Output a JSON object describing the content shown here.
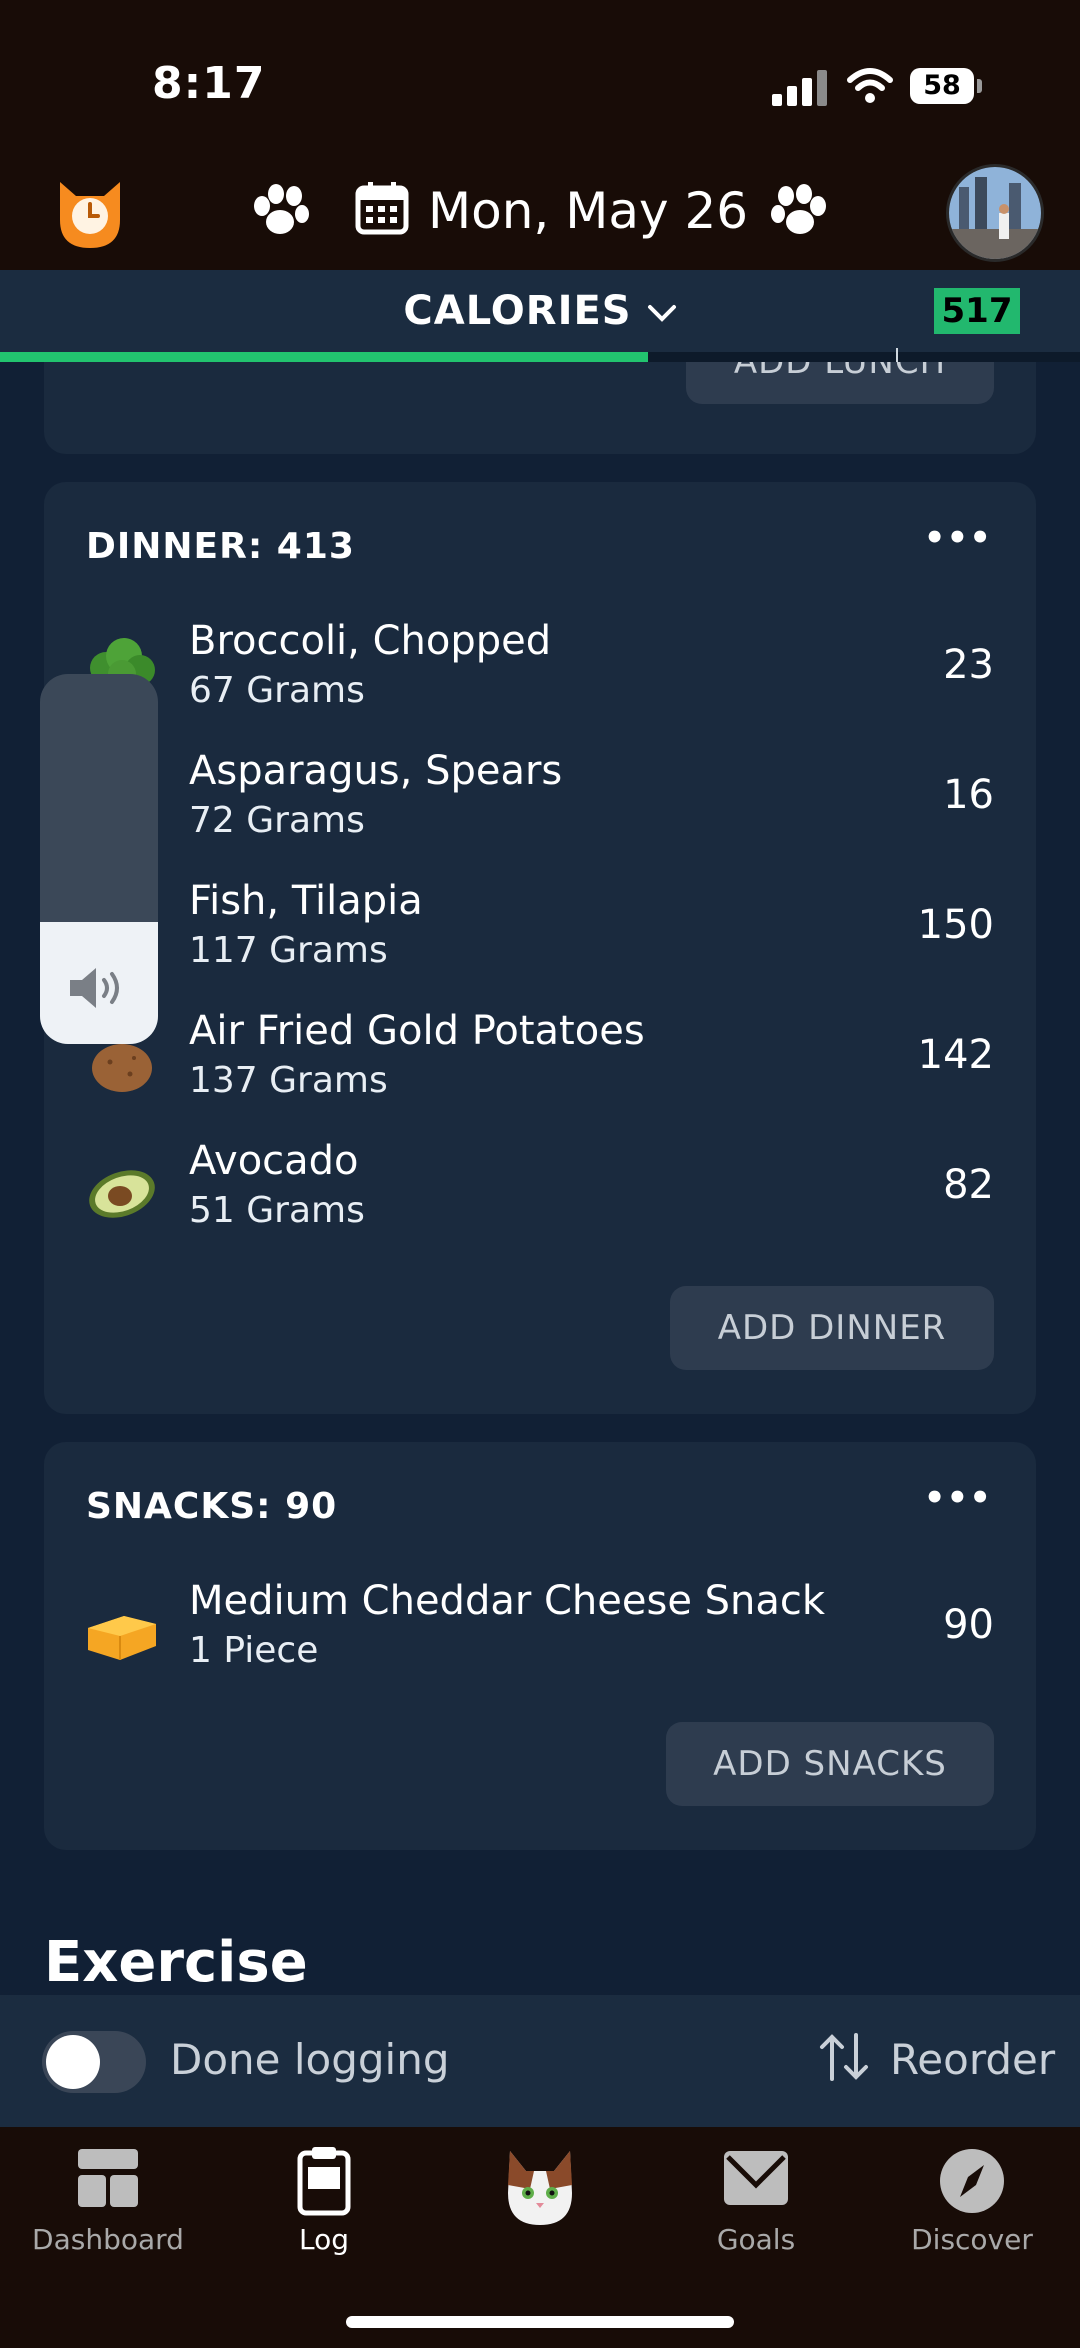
{
  "status_bar": {
    "time": "8:17",
    "battery": "58"
  },
  "header": {
    "date": "Mon, May 26"
  },
  "calorie_bar": {
    "label": "CALORIES",
    "remaining": "517",
    "progress": 0.6
  },
  "lunch": {
    "add_label": "ADD LUNCH"
  },
  "dinner": {
    "title": "DINNER: 413",
    "items": [
      {
        "name": "Broccoli, Chopped",
        "qty": "67 Grams",
        "cals": "23",
        "icon": "broccoli"
      },
      {
        "name": "Asparagus, Spears",
        "qty": "72 Grams",
        "cals": "16",
        "icon": "asparagus"
      },
      {
        "name": "Fish, Tilapia",
        "qty": "117 Grams",
        "cals": "150",
        "icon": "fish"
      },
      {
        "name": "Air Fried Gold Potatoes",
        "qty": "137 Grams",
        "cals": "142",
        "icon": "potato"
      },
      {
        "name": "Avocado",
        "qty": "51 Grams",
        "cals": "82",
        "icon": "avocado"
      }
    ],
    "add_label": "ADD DINNER"
  },
  "snacks": {
    "title": "SNACKS: 90",
    "items": [
      {
        "name": "Medium Cheddar Cheese Snack",
        "qty": "1 Piece",
        "cals": "90",
        "icon": "cheese"
      }
    ],
    "add_label": "ADD SNACKS"
  },
  "exercise": {
    "title": "Exercise"
  },
  "footer_bar": {
    "done_label": "Done logging",
    "reorder_label": "Reorder"
  },
  "tabs": [
    {
      "label": "Dashboard",
      "icon": "dashboard-icon"
    },
    {
      "label": "Log",
      "icon": "clipboard-icon"
    },
    {
      "label": "",
      "icon": "cat-mascot-icon"
    },
    {
      "label": "Goals",
      "icon": "goals-icon"
    },
    {
      "label": "Discover",
      "icon": "compass-icon"
    }
  ],
  "volume": {
    "level": 0.33
  },
  "colors": {
    "accent_green": "#22c46f",
    "card_bg": "#1a2a3e",
    "page_bg": "#112035",
    "top_bg": "#180c07"
  }
}
